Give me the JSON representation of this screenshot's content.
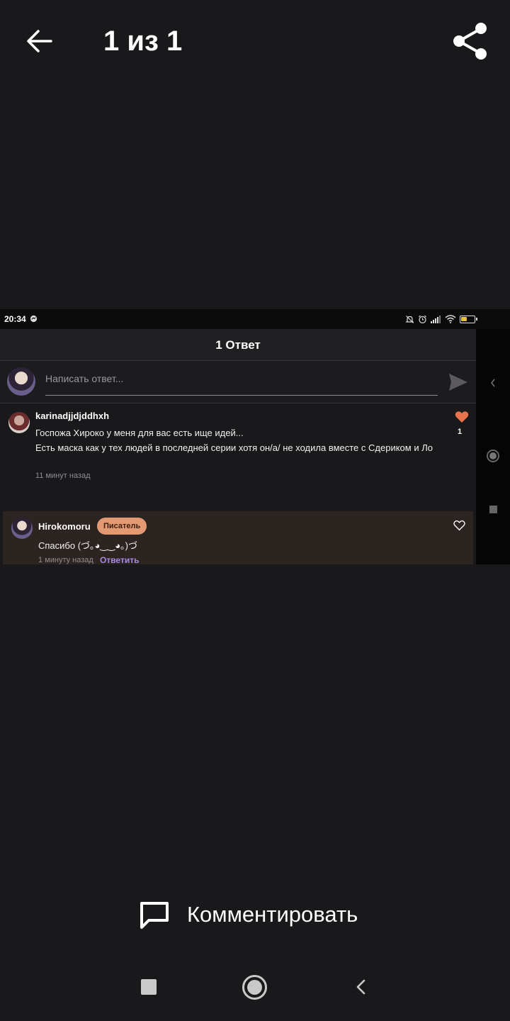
{
  "viewer": {
    "counter": "1 из 1",
    "back_icon": "arrow-left-icon",
    "share_icon": "share-icon"
  },
  "screenshot": {
    "status_bar": {
      "time": "20:34",
      "icons": [
        "messenger-icon",
        "mute-bell-icon",
        "alarm-icon",
        "signal-icon",
        "wifi-icon",
        "battery-icon"
      ],
      "battery_level": 0.45
    },
    "replies_header": {
      "title": "1 Ответ"
    },
    "reply_input": {
      "placeholder": "Написать ответ...",
      "send_icon": "send-icon"
    },
    "comment": {
      "username": "karinadjjdjddhxh",
      "text_line1": "Госпожа Хироко у меня для вас есть ище идей...",
      "text_line2": "Есть маска как у тех людей в последней серии хотя он/а/ не ходила вместе с Сдериком и Ло",
      "time": "11 минут назад",
      "likes": "1",
      "liked": true,
      "like_color": "#e8734a"
    },
    "reply": {
      "username": "Hirokomoru",
      "badge": "Писатель",
      "badge_color": "#e39a72",
      "text": "Спасибо (づ｡◕‿‿◕｡)づ",
      "time": "1 минуту назад",
      "reply_link": "Ответить",
      "link_color": "#a889e0"
    },
    "side_panel": {
      "icons": [
        "chevron-left-icon",
        "home-circle-icon",
        "recent-square-icon"
      ]
    }
  },
  "action": {
    "comment_label": "Комментировать",
    "comment_icon": "speech-bubble-icon"
  },
  "nav": {
    "icons": [
      "recent-apps-icon",
      "home-icon",
      "back-icon"
    ]
  }
}
